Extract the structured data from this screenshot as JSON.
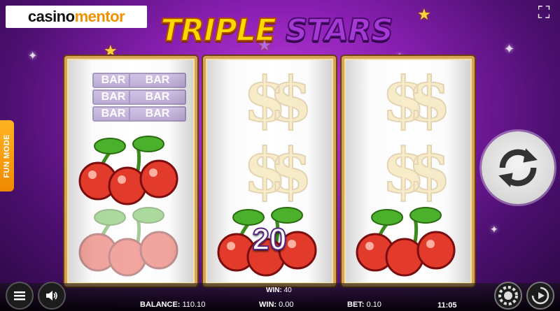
{
  "logo": {
    "part1": "casino",
    "part2": "mentor"
  },
  "title": {
    "word1": "TRIPLE",
    "word2": "STARS"
  },
  "side": {
    "fun_mode": "FUN MODE"
  },
  "reels": [
    [
      "bar",
      "cherries",
      "cherries"
    ],
    [
      "dollar",
      "dollar",
      "cherries"
    ],
    [
      "dollar",
      "dollar",
      "cherries"
    ]
  ],
  "bar_label": "BAR",
  "dollar_glyph": "$$",
  "win_display": "20",
  "footer": {
    "win_top_label": "WIN:",
    "win_top_value": "40",
    "balance_label": "BALANCE:",
    "balance_value": "110.10",
    "win_label": "WIN:",
    "win_value": "0.00",
    "bet_label": "BET:",
    "bet_value": "0.10",
    "clock": "11:05"
  },
  "icons": [
    "fullscreen-icon",
    "spin-icon",
    "menu-icon",
    "sound-icon",
    "chip-icon",
    "autoplay-icon"
  ],
  "colors": {
    "accent": "#f29100",
    "frame": "#d6a456",
    "background": "#8a1fb3"
  }
}
